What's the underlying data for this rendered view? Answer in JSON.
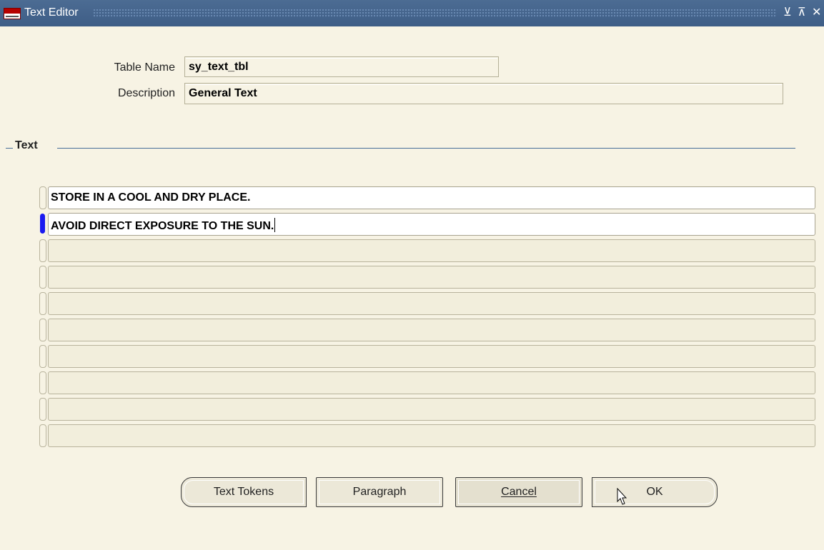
{
  "window": {
    "title": "Text Editor",
    "minimize_glyph": "⊻",
    "maximize_glyph": "⊼",
    "close_glyph": "✕"
  },
  "header": {
    "table_name_label": "Table Name",
    "table_name_value": "sy_text_tbl",
    "description_label": "Description",
    "description_value": "General Text"
  },
  "text_section": {
    "title": "Text",
    "lines": [
      "STORE IN A COOL AND DRY PLACE.",
      "AVOID DIRECT EXPOSURE TO THE SUN.",
      "",
      "",
      "",
      "",
      "",
      "",
      "",
      ""
    ]
  },
  "buttons": {
    "text_tokens": "Text Tokens",
    "paragraph": "Paragraph",
    "cancel": "Cancel",
    "ok": "OK"
  },
  "colors": {
    "titlebar": "#3e5d86",
    "background": "#f7f3e4",
    "active_row_indicator": "#1a1af0",
    "section_line": "#486e98"
  }
}
